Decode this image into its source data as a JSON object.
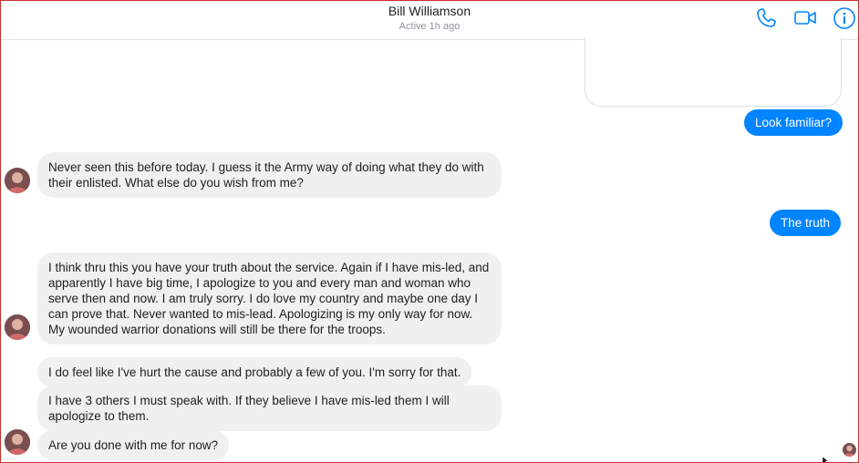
{
  "header": {
    "contact_name": "Bill Williamson",
    "status": "Active 1h ago",
    "icons": [
      "phone-icon",
      "video-camera-icon",
      "info-icon"
    ],
    "accent_color": "#0084ff"
  },
  "messages": [
    {
      "sender": "me",
      "text": "Look familiar?"
    },
    {
      "sender": "contact",
      "text": "Never seen this before today. I guess it the Army way of doing what they do with\ntheir enlisted. What else do you wish from me?"
    },
    {
      "sender": "me",
      "text": "The truth"
    },
    {
      "sender": "contact",
      "text": "I think thru this you have your truth about the service. Again if I have mis-led, and\napparently I have big time, I apologize to you and every man and woman who\nserve then and now. I am truly sorry. I do love my country and maybe one day I\ncan prove that. Never wanted to mis-lead. Apologizing is my only way for now.\nMy wounded warrior donations will still be there for the troops."
    },
    {
      "sender": "contact",
      "text": "I do feel like I've hurt the cause and probably a few of you. I'm sorry for that."
    },
    {
      "sender": "contact",
      "text": "I have 3 others I must speak with. If they believe I have mis-led them I will\napologize to them."
    },
    {
      "sender": "contact",
      "text": "Are you done with me for now?"
    }
  ],
  "colors": {
    "incoming_bubble": "#f1f0f0",
    "outgoing_bubble": "#0084ff",
    "frame_border": "#c9302c"
  }
}
